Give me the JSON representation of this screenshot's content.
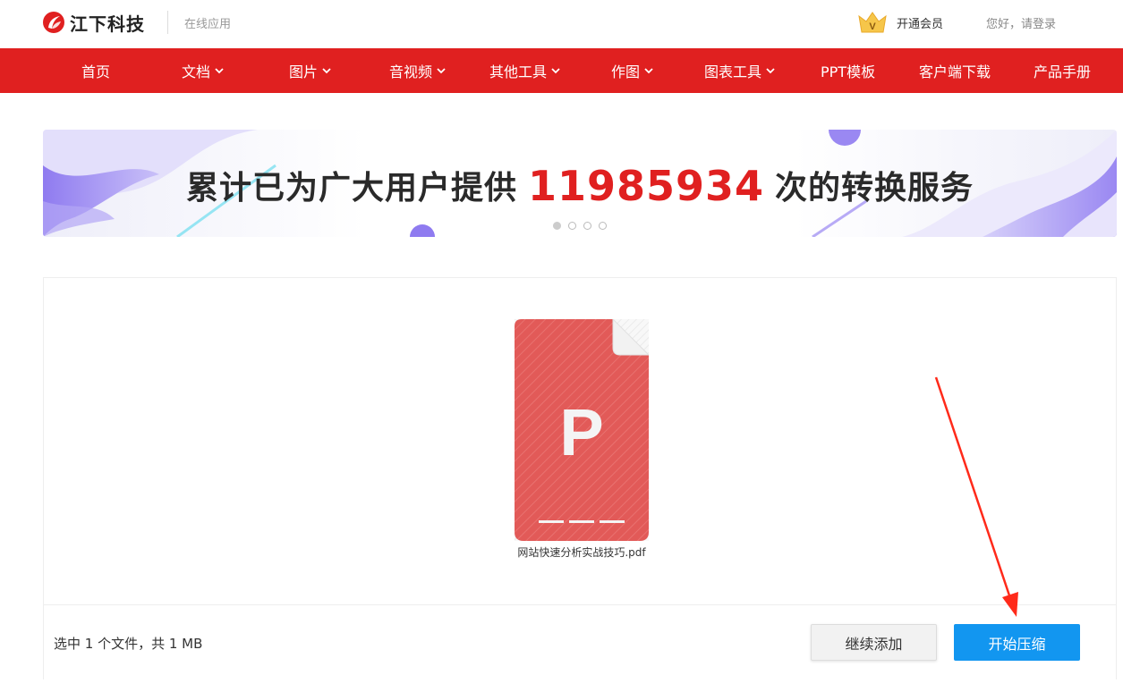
{
  "header": {
    "brand": "江下科技",
    "subtitle": "在线应用",
    "vip_label": "开通会员",
    "vip_badge": "V",
    "login_label": "您好，请登录"
  },
  "nav": {
    "items": [
      {
        "label": "首页",
        "dropdown": false
      },
      {
        "label": "文档",
        "dropdown": true
      },
      {
        "label": "图片",
        "dropdown": true
      },
      {
        "label": "音视频",
        "dropdown": true
      },
      {
        "label": "其他工具",
        "dropdown": true
      },
      {
        "label": "作图",
        "dropdown": true
      },
      {
        "label": "图表工具",
        "dropdown": true
      },
      {
        "label": "PPT模板",
        "dropdown": false
      },
      {
        "label": "客户端下载",
        "dropdown": false
      },
      {
        "label": "产品手册",
        "dropdown": false
      }
    ]
  },
  "banner": {
    "prefix": "累计已为广大用户提供",
    "count": "11985934",
    "suffix": "次的转换服务",
    "slides": 4,
    "active_slide": 1
  },
  "upload": {
    "file": {
      "name": "网站快速分析实战技巧.pdf",
      "icon_letter": "P",
      "icon_color": "#e25a58"
    },
    "summary": "选中 1 个文件，共 1 MB",
    "add_button": "继续添加",
    "start_button": "开始压缩"
  },
  "colors": {
    "brand_red": "#e02020",
    "primary_blue": "#1296f0",
    "annotation_red": "#ff2a1a"
  }
}
